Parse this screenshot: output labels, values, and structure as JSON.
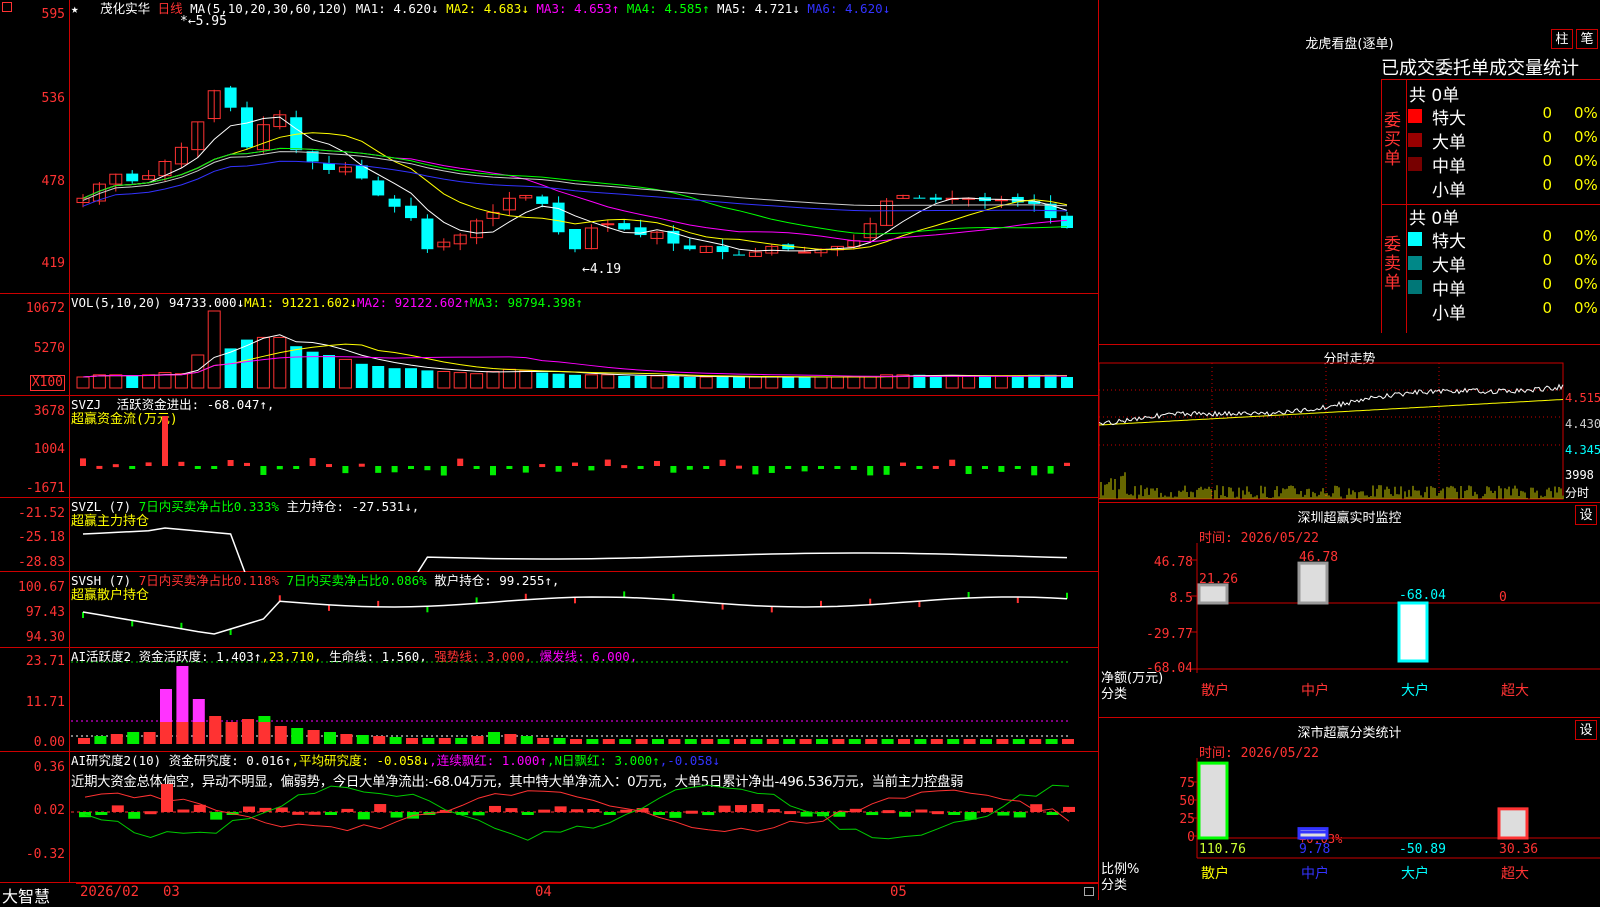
{
  "brand": "大智慧",
  "stock": {
    "name": "茂化实华",
    "period": "日线",
    "star": "★"
  },
  "kline": {
    "ma_label": "MA(5,10,20,30,60,120)",
    "ma1": "MA1: 4.620↓",
    "ma2": "MA2: 4.683↓",
    "ma3": "MA3: 4.653↑",
    "ma4": "MA4: 4.585↑",
    "ma5": "MA5: 4.721↓",
    "ma6": "MA6: 4.620↓",
    "high_note": "5.95",
    "low_note": "←4.19",
    "yticks": [
      "595",
      "536",
      "478",
      "419"
    ],
    "high": 5.95,
    "low": 4.19
  },
  "vol": {
    "label": "VOL(5,10,20)",
    "value": "94733.000↓",
    "ma1": "MA1: 91221.602↓",
    "ma2": "MA2: 92122.602↑",
    "ma3": "MA3: 98794.398↑",
    "yticks": [
      "10672",
      "5270",
      "X100"
    ]
  },
  "svzj": {
    "label": "SVZJ",
    "line": "活跃资金进出: -68.047↑,",
    "sub": "超赢资金流(万元)",
    "yticks": [
      "3678",
      "1004",
      "-1671"
    ]
  },
  "svzl": {
    "label": "SVZL (7)",
    "a": "7日内买卖净占比0.333%",
    "b": "主力持仓: -27.531↓,",
    "sub": "超赢主力持仓",
    "yticks": [
      "-21.52",
      "-25.18",
      "-28.83"
    ]
  },
  "svsh": {
    "label": "SVSH (7)",
    "a": "7日内买卖净占比0.118%",
    "b": "7日内买卖净占比0.086%",
    "c": "散户持仓: 99.255↑,",
    "sub": "超赢散户持仓",
    "yticks": [
      "100.67",
      "97.43",
      "94.30"
    ]
  },
  "ai1": {
    "label": "AI活跃度2",
    "a": "资金活跃度: 1.403↑",
    "b": ",23.710,",
    "c": "生命线: 1.560,",
    "d": "强势线: 3.000,",
    "e": "爆发线: 6.000,",
    "yticks": [
      "23.71",
      "11.71",
      "0.00"
    ]
  },
  "ai2": {
    "label": "AI研究度2(10)",
    "a": "资金研究度: 0.016↑",
    "b": ",平均研究度: -0.058↓",
    "c": ",连续飘红: 1.000↑",
    "d": ",N日飘红: 3.000↑",
    "e": ",-0.058↓",
    "comment": "近期大资金总体偏空，异动不明显，偏弱势，今日大单净流出:-68.04万元，其中特大单净流入：0万元，大单5日累计净出-496.536万元，当前主力控盘弱",
    "yticks": [
      "0.36",
      "0.02",
      "-0.32"
    ]
  },
  "xaxis": [
    "2026/02",
    "03",
    "04",
    "05"
  ],
  "lhb": {
    "title": "龙虎看盘(逐单)",
    "btn1": "柱",
    "btn2": "笔",
    "subtitle": "已成交委托单成交量统计",
    "buy_label": "委买单",
    "sell_label": "委卖单",
    "buy_total": "共 0单",
    "sell_total": "共 0单",
    "buy": [
      {
        "name": "特大",
        "val": "0",
        "pct": "0%",
        "color": "#ff0000"
      },
      {
        "name": "大单",
        "val": "0",
        "pct": "0%",
        "color": "#990000"
      },
      {
        "name": "中单",
        "val": "0",
        "pct": "0%",
        "color": "#770000"
      },
      {
        "name": "小单",
        "val": "0",
        "pct": "0%",
        "color": "#000000"
      }
    ],
    "sell": [
      {
        "name": "特大",
        "val": "0",
        "pct": "0%",
        "color": "#00ffff"
      },
      {
        "name": "大单",
        "val": "0",
        "pct": "0%",
        "color": "#008888"
      },
      {
        "name": "中单",
        "val": "0",
        "pct": "0%",
        "color": "#007777"
      },
      {
        "name": "小单",
        "val": "0",
        "pct": "0%",
        "color": "#000000"
      }
    ]
  },
  "fenshi": {
    "title": "分时走势",
    "yticks": [
      "4.515",
      "4.430",
      "4.345"
    ],
    "vol_label": "3998",
    "vol_sub": "分时"
  },
  "sz_monitor": {
    "title": "深圳超赢实时监控",
    "btn": "设",
    "date": "时间: 2026/05/22",
    "yticks": [
      "46.78",
      "8.5",
      "-29.77",
      "-68.04"
    ],
    "unit": "净额(万元)",
    "cat_label": "分类",
    "bars": [
      {
        "cat": "散户",
        "value": 21.26,
        "label": "21.26"
      },
      {
        "cat": "中户",
        "value": 46.78,
        "label": "46.78"
      },
      {
        "cat": "大户",
        "value": -68.04,
        "label": "-68.04"
      },
      {
        "cat": "超大",
        "value": 0,
        "label": "0"
      }
    ]
  },
  "sz_class": {
    "title": "深市超赢分类统计",
    "btn": "设",
    "date": "时间: 2026/05/22",
    "yticks": [
      "75",
      "50",
      "25",
      "0"
    ],
    "unit": "比例%",
    "cat_label": "分类",
    "bars": [
      {
        "cat": "散户",
        "value": 110.76,
        "label": "110.76"
      },
      {
        "cat": "中户",
        "value": 9.78,
        "label": "9.78"
      },
      {
        "cat": "大户",
        "value": -50.89,
        "label": "-50.89"
      },
      {
        "cat": "超大",
        "value": 30.36,
        "label": "30.36"
      }
    ],
    "note": "+0.03%"
  }
}
